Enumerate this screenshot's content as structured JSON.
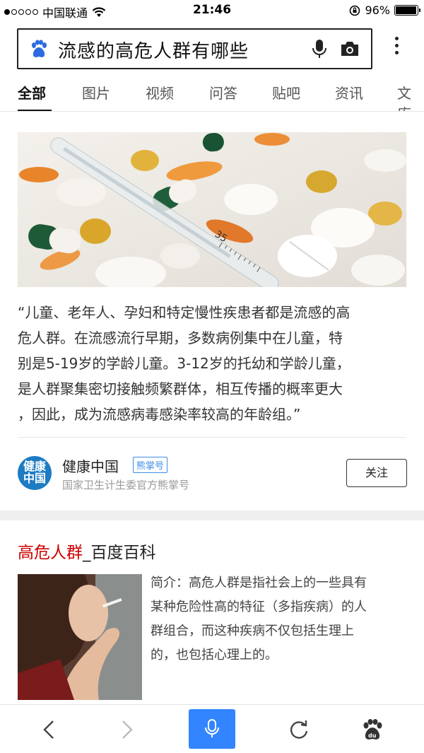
{
  "status_bar": {
    "carrier": "中国联通",
    "time": "21:46",
    "battery": "96%",
    "battery_level": 0.96
  },
  "search": {
    "query": "流感的高危人群有哪些"
  },
  "tabs": [
    {
      "label": "全部",
      "active": true
    },
    {
      "label": "图片"
    },
    {
      "label": "视频"
    },
    {
      "label": "问答"
    },
    {
      "label": "贴吧"
    },
    {
      "label": "资讯"
    },
    {
      "label": "文库"
    }
  ],
  "card1": {
    "thermometer_mark": "35",
    "quote_lines": [
      "“儿童、老年人、孕妇和特定慢性疾患者都是流感的高",
      "危人群。在流感流行早期，多数病例集中在儿童，特",
      "别是5-19岁的学龄儿童。3-12岁的托幼和学龄儿童，",
      "是人群聚集密切接触频繁群体，相互传播的概率更大",
      "，因此，成为流感病毒感染率较高的年龄组。”"
    ],
    "avatar_text_1": "健康",
    "avatar_text_2": "中国",
    "source_name": "健康中国",
    "badge": "熊掌号",
    "source_desc": "国家卫生计生委官方熊掌号",
    "follow_label": "关注"
  },
  "card2": {
    "title_highlight": "高危人群",
    "title_rest": "_百度百科",
    "desc_lines": [
      "简介：高危人群是指社会上的一些具有",
      "某种危险性高的特征（多指疾病）的人",
      "群组合，而这种疾病不仅包括生理上",
      "的，也包括心理上的。"
    ]
  },
  "bottom_bar": {
    "icons": [
      "back-icon",
      "forward-icon",
      "microphone-icon",
      "refresh-icon",
      "baidu-paw-icon"
    ]
  },
  "colors": {
    "accent": "#3385ff",
    "highlight": "#cc0000"
  }
}
